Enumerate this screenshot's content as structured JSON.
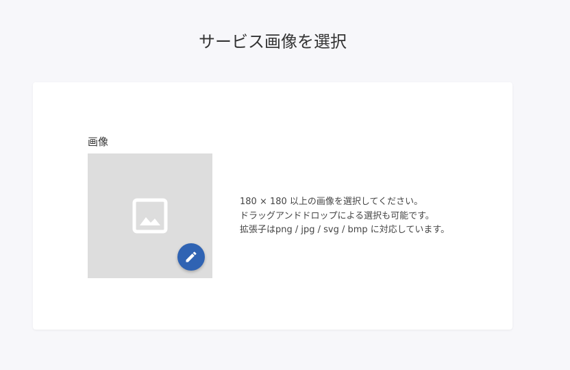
{
  "page": {
    "title": "サービス画像を選択"
  },
  "image_field": {
    "label": "画像",
    "placeholder_icon": "image-placeholder-icon",
    "edit_icon": "pencil-icon",
    "edit_button_color": "#2f63b3",
    "hints": [
      "180 × 180 以上の画像を選択してください。",
      "ドラッグアンドドロップによる選択も可能です。",
      "拡張子はpng / jpg / svg / bmp に対応しています。"
    ]
  },
  "colors": {
    "background": "#f7f7fa",
    "card": "#ffffff",
    "placeholder": "#dddddd"
  }
}
